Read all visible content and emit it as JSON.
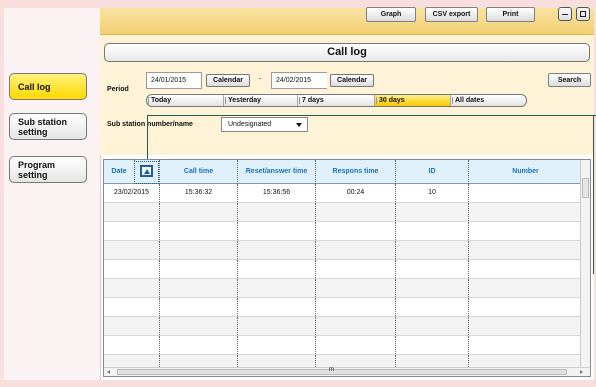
{
  "toolbar": {
    "graph": "Graph",
    "csv_export": "CSV export",
    "print": "Print"
  },
  "window_controls": {
    "minimize_icon": "minimize-icon",
    "maximize_icon": "maximize-icon"
  },
  "title": "Call log",
  "sidebar": {
    "items": [
      {
        "label": "Call log",
        "active": true
      },
      {
        "label": "Sub station setting",
        "active": false
      },
      {
        "label": "Program setting",
        "active": false
      }
    ]
  },
  "period": {
    "label": "Period",
    "from": "24/01/2015",
    "to": "24/02/2015",
    "separator": "-",
    "calendar_label": "Calendar",
    "search": "Search",
    "ranges": [
      {
        "label": "Today",
        "selected": false
      },
      {
        "label": "Yesterday",
        "selected": false
      },
      {
        "label": "7 days",
        "selected": false
      },
      {
        "label": "30 days",
        "selected": true
      },
      {
        "label": "All dates",
        "selected": false
      }
    ]
  },
  "substation": {
    "label": "Sub station number/name",
    "selected": "Undesignated"
  },
  "table": {
    "columns": [
      "Date",
      "Call time",
      "Reset/answer time",
      "Respons time",
      "ID",
      "Number"
    ],
    "rows": [
      [
        "23/02/2015",
        "15:36:32",
        "15:36:56",
        "00:24",
        "10",
        ""
      ]
    ]
  },
  "scroll": {
    "marker": "m"
  },
  "colors": {
    "active_nav": "#ffd900",
    "header_text": "#1973b8",
    "callout": "#215f55"
  }
}
